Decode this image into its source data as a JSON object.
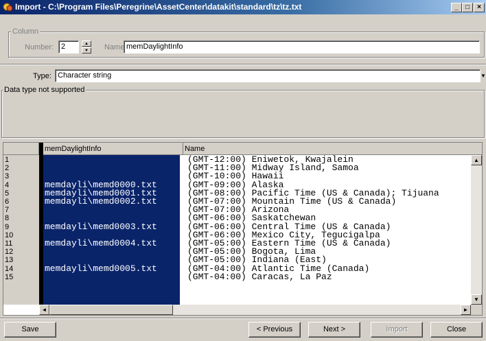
{
  "window": {
    "title": "Import - C:\\Program Files\\Peregrine\\AssetCenter\\datakit\\standard\\tz\\tz.txt",
    "minimize": "_",
    "maximize": "□",
    "close": "×"
  },
  "column_group": {
    "label": "Column",
    "number_label": "Number:",
    "number_value": "2",
    "name_label": "Name:",
    "name_value": "memDaylightInfo"
  },
  "type": {
    "label": "Type:",
    "value": "Character string"
  },
  "data_type_group": {
    "label": "Data type not supported"
  },
  "grid": {
    "columns": [
      "memDaylightInfo",
      "Name"
    ],
    "rows": [
      {
        "n": "1",
        "c1": "",
        "c2": "(GMT-12:00) Eniwetok, Kwajalein"
      },
      {
        "n": "2",
        "c1": "",
        "c2": "(GMT-11:00) Midway Island, Samoa"
      },
      {
        "n": "3",
        "c1": "",
        "c2": "(GMT-10:00) Hawaii"
      },
      {
        "n": "4",
        "c1": "memdayli\\memd0000.txt",
        "c2": "(GMT-09:00) Alaska"
      },
      {
        "n": "5",
        "c1": "memdayli\\memd0001.txt",
        "c2": "(GMT-08:00) Pacific Time (US & Canada); Tijuana"
      },
      {
        "n": "6",
        "c1": "memdayli\\memd0002.txt",
        "c2": "(GMT-07:00) Mountain Time (US & Canada)"
      },
      {
        "n": "7",
        "c1": "",
        "c2": "(GMT-07:00) Arizona"
      },
      {
        "n": "8",
        "c1": "",
        "c2": "(GMT-06:00) Saskatchewan"
      },
      {
        "n": "9",
        "c1": "memdayli\\memd0003.txt",
        "c2": "(GMT-06:00) Central Time (US & Canada)"
      },
      {
        "n": "10",
        "c1": "",
        "c2": "(GMT-06:00) Mexico City, Tegucigalpa"
      },
      {
        "n": "11",
        "c1": "memdayli\\memd0004.txt",
        "c2": "(GMT-05:00) Eastern Time (US & Canada)"
      },
      {
        "n": "12",
        "c1": "",
        "c2": "(GMT-05:00) Bogota, Lima"
      },
      {
        "n": "13",
        "c1": "",
        "c2": "(GMT-05:00) Indiana (East)"
      },
      {
        "n": "14",
        "c1": "memdayli\\memd0005.txt",
        "c2": "(GMT-04:00) Atlantic Time (Canada)"
      },
      {
        "n": "15",
        "c1": "",
        "c2": "(GMT-04:00) Caracas, La Paz"
      }
    ]
  },
  "buttons": {
    "save": "Save",
    "previous": "< Previous",
    "next": "Next >",
    "import": "Import",
    "close": "Close"
  },
  "colors": {
    "selection": "#0a246a",
    "face": "#d4d0c8",
    "titlebar": "#0a246a"
  }
}
